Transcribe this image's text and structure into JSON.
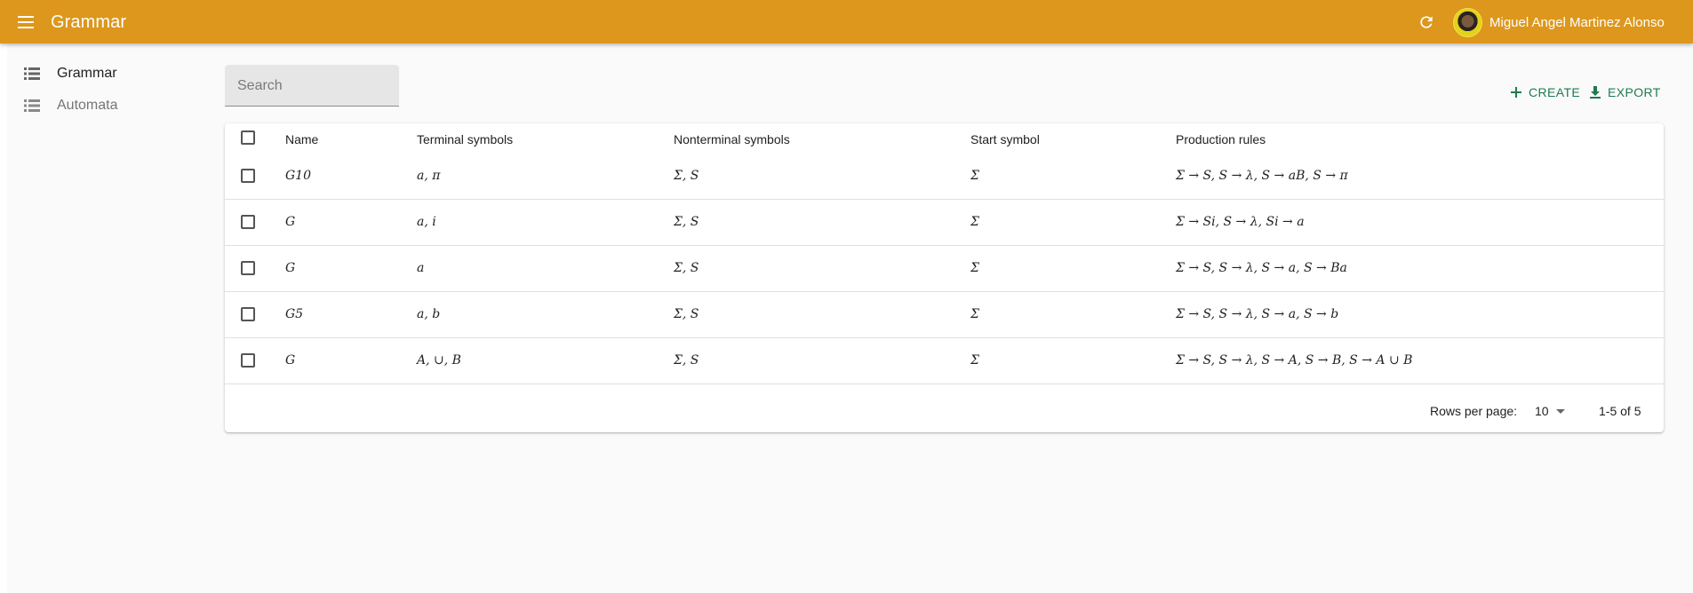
{
  "appbar": {
    "title": "Grammar",
    "user_name": "Miguel Angel Martinez Alonso",
    "color": "#dd971c",
    "icons": [
      "menu-icon",
      "refresh-icon",
      "avatar"
    ]
  },
  "sidebar": {
    "items": [
      {
        "label": "Grammar",
        "icon": "list-icon",
        "active": true
      },
      {
        "label": "Automata",
        "icon": "list-icon",
        "active": false
      }
    ]
  },
  "search": {
    "placeholder": "Search",
    "value": ""
  },
  "toolbar": {
    "create_label": "CREATE",
    "export_label": "EXPORT",
    "accent": "#1f7a4f"
  },
  "table": {
    "headers": {
      "name": "Name",
      "terminal": "Terminal symbols",
      "nonterminal": "Nonterminal symbols",
      "start": "Start symbol",
      "rules": "Production rules"
    },
    "rows": [
      {
        "name": "G10",
        "terminal": "a, π",
        "nonterminal": "Σ, S",
        "start": "Σ",
        "rules": "Σ → S, S → λ, S → aB, S → π"
      },
      {
        "name": "G",
        "terminal": "a, i",
        "nonterminal": "Σ, S",
        "start": "Σ",
        "rules": "Σ → Si, S → λ, Si → a"
      },
      {
        "name": "G",
        "terminal": "a",
        "nonterminal": "Σ, S",
        "start": "Σ",
        "rules": "Σ → S, S → λ, S → a, S → Ba"
      },
      {
        "name": "G5",
        "terminal": "a, b",
        "nonterminal": "Σ, S",
        "start": "Σ",
        "rules": "Σ → S, S → λ, S → a, S → b"
      },
      {
        "name": "G",
        "terminal": "A, ∪, B",
        "nonterminal": "Σ, S",
        "start": "Σ",
        "rules": "Σ → S, S → λ, S → A, S → B, S → A ∪ B"
      }
    ]
  },
  "pagination": {
    "rows_per_page_label": "Rows per page:",
    "rows_per_page": "10",
    "range": "1-5 of 5"
  }
}
